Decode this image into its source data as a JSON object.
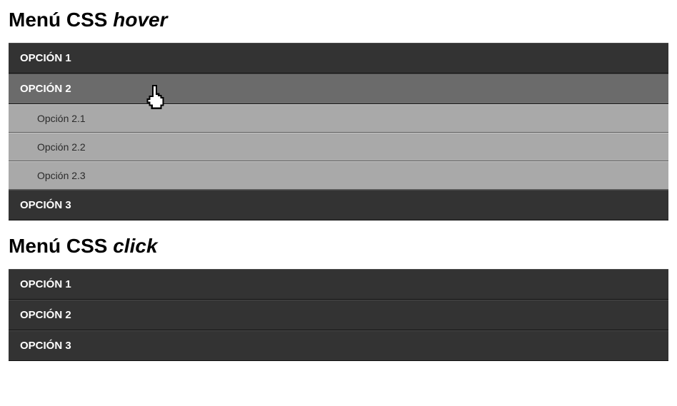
{
  "heading_hover_prefix": "Menú CSS ",
  "heading_hover_em": "hover",
  "heading_click_prefix": "Menú CSS ",
  "heading_click_em": "click",
  "menu_hover": {
    "items": [
      {
        "label": "OPCIÓN 1"
      },
      {
        "label": "OPCIÓN 2",
        "hovered": true,
        "submenu": [
          {
            "label": "Opción 2.1"
          },
          {
            "label": "Opción 2.2"
          },
          {
            "label": "Opción 2.3"
          }
        ]
      },
      {
        "label": "OPCIÓN 3"
      }
    ]
  },
  "menu_click": {
    "items": [
      {
        "label": "OPCIÓN 1"
      },
      {
        "label": "OPCIÓN 2"
      },
      {
        "label": "OPCIÓN 3"
      }
    ]
  },
  "cursor_icon_name": "hand-pointer-icon"
}
